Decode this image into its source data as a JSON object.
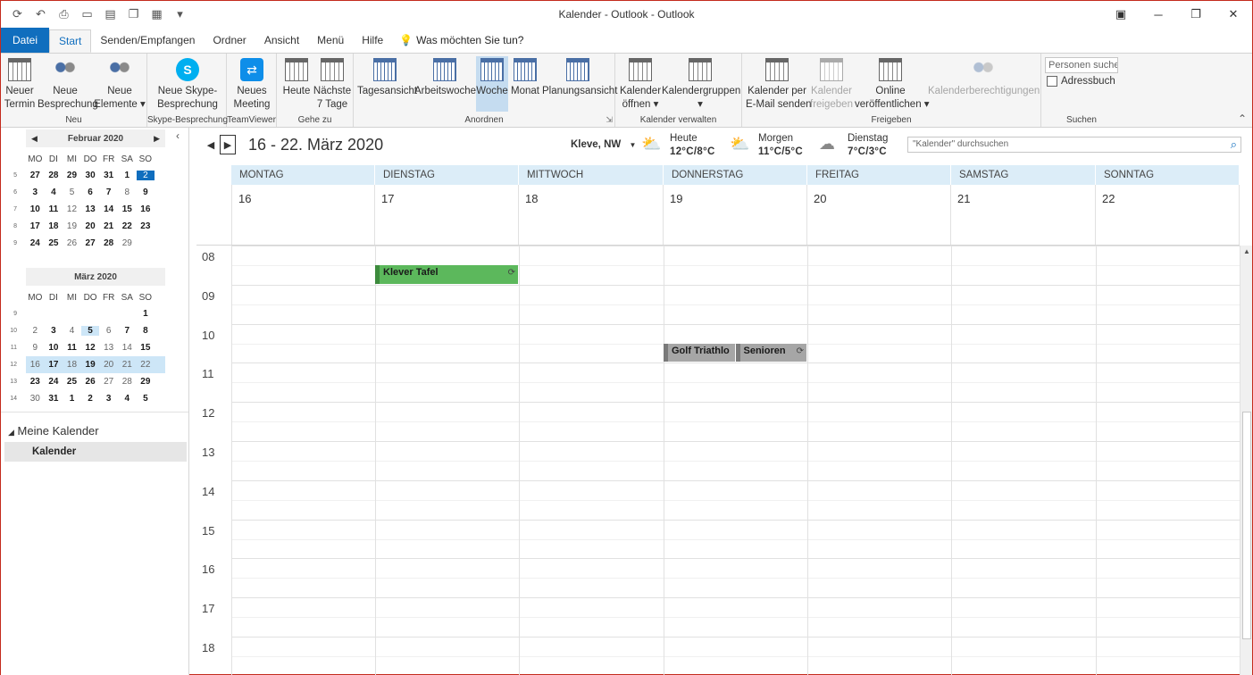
{
  "window": {
    "title": "Kalender - Outlook  -  Outlook"
  },
  "tabs": [
    {
      "label": "Datei"
    },
    {
      "label": "Start"
    },
    {
      "label": "Senden/Empfangen"
    },
    {
      "label": "Ordner"
    },
    {
      "label": "Ansicht"
    },
    {
      "label": "Menü"
    },
    {
      "label": "Hilfe"
    }
  ],
  "tell_me": "Was möchten Sie tun?",
  "ribbon": {
    "neu": {
      "label": "Neu",
      "termin": "Neuer\nTermin",
      "besprechung": "Neue\nBesprechung",
      "elemente": "Neue\nElemente ▾"
    },
    "skype": {
      "label": "Skype-Besprechung",
      "button": "Neue Skype-\nBesprechung"
    },
    "teamviewer": {
      "label": "TeamViewer",
      "button": "Neues\nMeeting"
    },
    "gehezu": {
      "label": "Gehe zu",
      "heute": "Heute",
      "naechste": "Nächste\n7 Tage"
    },
    "anordnen": {
      "label": "Anordnen",
      "tagesansicht": "Tagesansicht",
      "arbeitswoche": "Arbeitswoche",
      "woche": "Woche",
      "monat": "Monat",
      "planungsansicht": "Planungsansicht"
    },
    "verwalten": {
      "label": "Kalender verwalten",
      "oeffnen": "Kalender\nöffnen ▾",
      "gruppen": "Kalendergruppen\n▾"
    },
    "freigeben": {
      "label": "Freigeben",
      "email": "Kalender per\nE-Mail senden",
      "freigeben": "Kalender\nfreigeben",
      "online": "Online\nveröffentlichen ▾",
      "berechtigungen": "Kalenderberechtigungen"
    },
    "suchen": {
      "label": "Suchen",
      "personen_placeholder": "Personen suchen",
      "adressbuch": "Adressbuch"
    }
  },
  "nav": {
    "feb": {
      "title": "Februar 2020",
      "dows": [
        "MO",
        "DI",
        "MI",
        "DO",
        "FR",
        "SA",
        "SO"
      ],
      "weeks": [
        {
          "wn": "5",
          "days": [
            "27",
            "28",
            "29",
            "30",
            "31",
            "1",
            "2"
          ]
        },
        {
          "wn": "6",
          "days": [
            "3",
            "4",
            "5",
            "6",
            "7",
            "8",
            "9"
          ]
        },
        {
          "wn": "7",
          "days": [
            "10",
            "11",
            "12",
            "13",
            "14",
            "15",
            "16"
          ]
        },
        {
          "wn": "8",
          "days": [
            "17",
            "18",
            "19",
            "20",
            "21",
            "22",
            "23"
          ]
        },
        {
          "wn": "9",
          "days": [
            "24",
            "25",
            "26",
            "27",
            "28",
            "29",
            ""
          ]
        }
      ]
    },
    "mar": {
      "title": "März 2020",
      "dows": [
        "MO",
        "DI",
        "MI",
        "DO",
        "FR",
        "SA",
        "SO"
      ],
      "weeks": [
        {
          "wn": "9",
          "days": [
            "",
            "",
            "",
            "",
            "",
            "",
            "1"
          ]
        },
        {
          "wn": "10",
          "days": [
            "2",
            "3",
            "4",
            "5",
            "6",
            "7",
            "8"
          ]
        },
        {
          "wn": "11",
          "days": [
            "9",
            "10",
            "11",
            "12",
            "13",
            "14",
            "15"
          ]
        },
        {
          "wn": "12",
          "days": [
            "16",
            "17",
            "18",
            "19",
            "20",
            "21",
            "22"
          ]
        },
        {
          "wn": "13",
          "days": [
            "23",
            "24",
            "25",
            "26",
            "27",
            "28",
            "29"
          ]
        },
        {
          "wn": "14",
          "days": [
            "30",
            "31",
            "1",
            "2",
            "3",
            "4",
            "5"
          ]
        }
      ]
    },
    "my_calendars": "Meine Kalender",
    "calendar_item": "Kalender"
  },
  "calendar": {
    "range": "16 - 22. März 2020",
    "location": "Kleve, NW",
    "weather": [
      {
        "day": "Heute",
        "temp": "12°C/8°C"
      },
      {
        "day": "Morgen",
        "temp": "11°C/5°C"
      },
      {
        "day": "Dienstag",
        "temp": "7°C/3°C"
      }
    ],
    "search_placeholder": "\"Kalender\" durchsuchen",
    "days": [
      {
        "name": "MONTAG",
        "num": "16"
      },
      {
        "name": "DIENSTAG",
        "num": "17"
      },
      {
        "name": "MITTWOCH",
        "num": "18"
      },
      {
        "name": "DONNERSTAG",
        "num": "19"
      },
      {
        "name": "FREITAG",
        "num": "20"
      },
      {
        "name": "SAMSTAG",
        "num": "21"
      },
      {
        "name": "SONNTAG",
        "num": "22"
      }
    ],
    "hours": [
      "08",
      "09",
      "10",
      "11",
      "12",
      "13",
      "14",
      "15",
      "16",
      "17",
      "18"
    ],
    "events": [
      {
        "title": "Klever Tafel",
        "day": "17",
        "start": "08:00",
        "end": "08:30",
        "color": "#5cb85c"
      },
      {
        "title": "Golf Triathlo",
        "day": "19",
        "start": "10:00",
        "end": "10:30",
        "color": "#a6a6a6"
      },
      {
        "title": "Senioren",
        "day": "19",
        "start": "10:00",
        "end": "10:30",
        "color": "#a6a6a6"
      }
    ]
  },
  "colors": {
    "accent": "#106ebe",
    "day_header": "#dcedf8",
    "selected_button": "#c5dcf0"
  }
}
